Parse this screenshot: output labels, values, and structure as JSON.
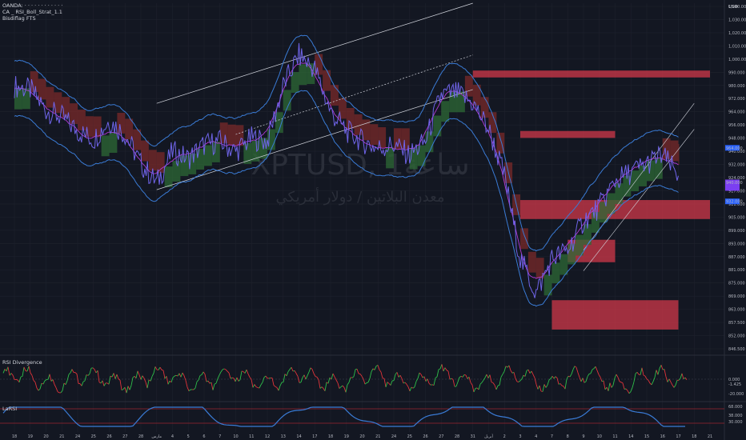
{
  "header": {
    "title_line": "OANDA: · · · · · · · · · · · ·",
    "indicator_1": "CA _ RSI_Boll_Strat_1.1",
    "indicator_2": "Bisdiflag FTS"
  },
  "watermark": {
    "symbol": "XPTUSD, 1ساعة",
    "description": "معدن البلاتين / دولار أمريكي"
  },
  "currency_label": "USD",
  "colors": {
    "background": "#131722",
    "price": "#6f64e8",
    "band": "#3a7bd5",
    "mid": "#b23ad5",
    "bull": "#2d6a35",
    "bear": "#7a2a2a",
    "zone": "#d0384a",
    "rsi_up": "#26a69a",
    "rsi_down": "#ef5350",
    "laRSI": "#3a7bd5"
  },
  "chart_data": {
    "type": "line",
    "title": "XPTUSD, 1ساعة",
    "ylabel": "USD",
    "ylim": [
      846,
      1048
    ],
    "y_ticks": [
      "1,040.000",
      "1,030.000",
      "1,020.000",
      "1,010.000",
      "1,000.000",
      "990.000",
      "980.000",
      "972.000",
      "964.000",
      "956.000",
      "948.000",
      "940.000",
      "932.000",
      "924.000",
      "917.000",
      "911.000",
      "905.000",
      "899.000",
      "893.000",
      "887.000",
      "881.000",
      "875.000",
      "869.000",
      "863.000",
      "857.500",
      "852.000",
      "846.500"
    ],
    "x_ticks": [
      "18",
      "19",
      "20",
      "21",
      "24",
      "25",
      "26",
      "27",
      "28",
      "مارس",
      "4",
      "5",
      "6",
      "7",
      "10",
      "11",
      "12",
      "13",
      "14",
      "17",
      "18",
      "19",
      "20",
      "21",
      "24",
      "25",
      "26",
      "27",
      "28",
      "31",
      "أبريل",
      "2",
      "3",
      "4",
      "7",
      "8",
      "9",
      "10",
      "11",
      "14",
      "15",
      "16",
      "17",
      "18",
      "21"
    ],
    "price_tags": [
      {
        "label": "964.000",
        "color": "#2962ff"
      },
      {
        "label": "940.000",
        "color": "#7b3ff2"
      },
      {
        "label": "932.000",
        "color": "#2962ff"
      }
    ],
    "zones": [
      {
        "name": "zone-top",
        "from_x": "31",
        "to_x": "21",
        "y_low": 1005,
        "y_high": 1009
      },
      {
        "name": "zone-mid",
        "from_x": "11",
        "to_x": "3",
        "y_low": 970,
        "y_high": 974
      },
      {
        "name": "zone-right-upper",
        "from_x": "3",
        "to_x": "21",
        "y_low": 923,
        "y_high": 934
      },
      {
        "name": "zone-right-lower",
        "from_x": "8",
        "to_x": "11",
        "y_low": 898,
        "y_high": 911
      },
      {
        "name": "zone-bottom",
        "from_x": "7",
        "to_x": "17",
        "y_low": 859,
        "y_high": 876
      }
    ],
    "series": [
      {
        "name": "",
        "x": [
          "18",
          "19",
          "20",
          "21",
          "24",
          "25",
          "26",
          "27",
          "28",
          "مارس",
          "4",
          "5",
          "6",
          "7",
          "10",
          "11",
          "12",
          "13",
          "14",
          "17",
          "18",
          "19",
          "20",
          "21",
          "24",
          "25",
          "26",
          "27",
          "28",
          "31",
          "أبريل",
          "2",
          "3",
          "4",
          "7",
          "8",
          "9",
          "10",
          "11",
          "14",
          "15",
          "16",
          "17"
        ],
        "values": [
          1000,
          998,
          986,
          982,
          974,
          969,
          980,
          972,
          955,
          944,
          962,
          958,
          966,
          968,
          962,
          970,
          968,
          1000,
          1018,
          1010,
          985,
          974,
          968,
          964,
          966,
          960,
          968,
          995,
          996,
          990,
          975,
          948,
          900,
          880,
          900,
          905,
          922,
          930,
          945,
          950,
          955,
          960,
          948
        ]
      }
    ],
    "subcharts": [
      {
        "name": "RSI Divergence",
        "levels": [
          "0.000",
          "-1.425",
          "-20.000"
        ]
      },
      {
        "name": "LaRSI",
        "levels": [
          "68.000",
          "38.000",
          "30.000"
        ]
      }
    ]
  }
}
